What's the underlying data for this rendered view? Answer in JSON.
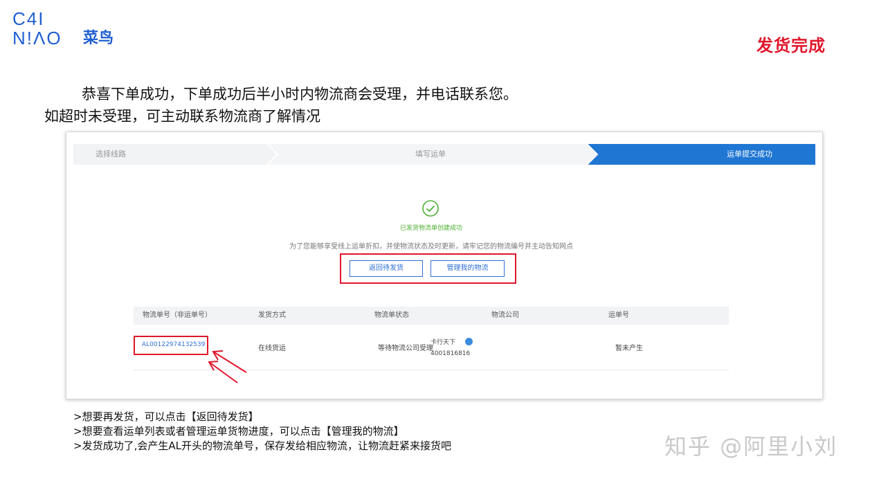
{
  "logo": {
    "line1": "C4I",
    "line2": "N!ΛO",
    "chinese": "菜鸟"
  },
  "page_title": "发货完成",
  "intro": {
    "line1": "恭喜下单成功，下单成功后半小时内物流商会受理，并电话联系您。",
    "line2": "如超时未受理，可主动联系物流商了解情况"
  },
  "steps": {
    "step1": "选择线路",
    "step2": "填写运单",
    "step3": "运单提交成功",
    "active_color": "#1f76d3",
    "inactive_color": "#f2f3f5"
  },
  "success": {
    "icon": "check-circle-icon",
    "message": "已发货物流单创建成功",
    "hint": "为了您能够享受线上运单折扣，并使物流状态及时更新，请牢记您的物流编号并主动告知网点"
  },
  "buttons": {
    "back": "返回待发货",
    "manage": "管理我的物流"
  },
  "table": {
    "headers": [
      "物流单号（非运单号）",
      "发货方式",
      "物流单状态",
      "物流公司",
      "运单号"
    ],
    "row": {
      "order_no": "AL00122974132539",
      "method": "在线货运",
      "status": "等待物流公司受理",
      "carrier": "卡行天下",
      "carrier_phone": "4001816816",
      "waybill": "暂未产生"
    }
  },
  "notes": [
    ">想要再发货，可以点击【返回待发货】",
    ">想要查看运单列表或者管理运单货物进度，可以点击【管理我的物流】",
    ">发货成功了,会产生AL开头的物流单号，保存发给相应物流，让物流赶紧来接货吧"
  ],
  "watermark": "知乎 @阿里小刘",
  "colors": {
    "brand_blue": "#1f5fd1",
    "highlight_red": "#e0162b",
    "success_green": "#4caf32"
  }
}
